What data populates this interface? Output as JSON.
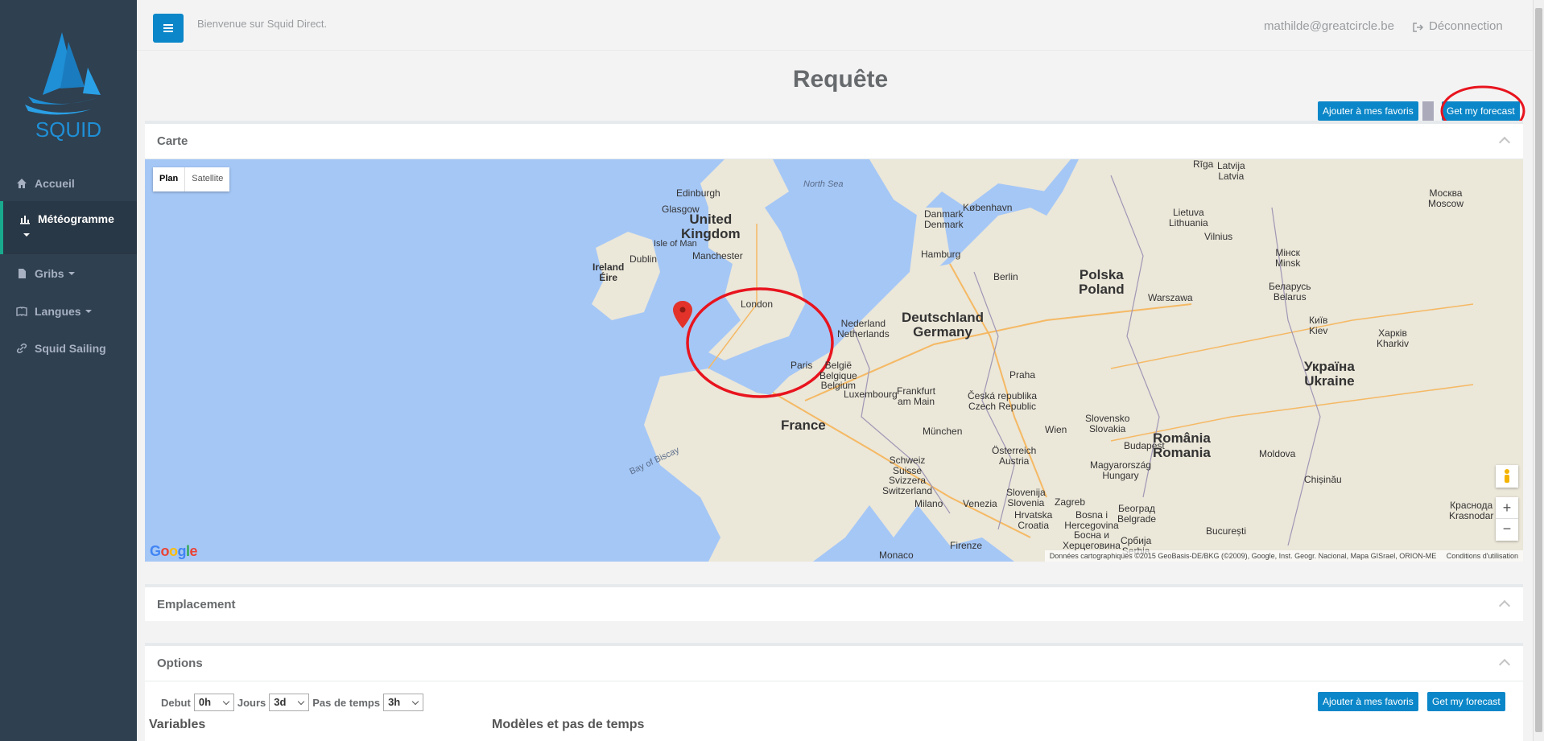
{
  "app": {
    "logo_text": "SQUID"
  },
  "sidebar": {
    "items": [
      {
        "label": "Accueil",
        "icon": "home-icon"
      },
      {
        "label": "Météogramme",
        "icon": "bar-chart-icon"
      },
      {
        "label": "Gribs",
        "icon": "file-icon"
      },
      {
        "label": "Langues",
        "icon": "book-icon"
      },
      {
        "label": "Squid Sailing",
        "icon": "link-icon"
      }
    ]
  },
  "topbar": {
    "welcome": "Bienvenue sur Squid Direct.",
    "user": "mathilde@greatcircle.be",
    "logout": "Déconnection"
  },
  "page": {
    "title": "Requête",
    "favorite_button": "Ajouter à mes favoris",
    "forecast_button": "Get my forecast"
  },
  "panels": {
    "map_title": "Carte",
    "location_title": "Emplacement",
    "options_title": "Options"
  },
  "map": {
    "type_plan": "Plan",
    "type_satellite": "Satellite",
    "google": "Google",
    "attribution": "Données cartographiques ©2015 GeoBasis-DE/BKG (©2009), Google, Inst. Geogr. Nacional, Mapa GISrael, ORION-ME",
    "terms": "Conditions d'utilisation",
    "labels": {
      "north_sea": "North Sea",
      "bay_biscay": "Bay of Biscay",
      "uk": "United\nKingdom",
      "ireland": "Ireland\nÉire",
      "france": "France",
      "germany": "Deutschland\nGermany",
      "poland": "Polska\nPoland",
      "ukraine": "Україна\nUkraine",
      "romania": "România\nRomania",
      "netherlands": "Nederland\nNetherlands",
      "belgium": "België\nBelgique\nBelgium",
      "luxembourg": "Luxembourg",
      "denmark": "Danmark\nDenmark",
      "latvia": "Latvija\nLatvia",
      "lithuania": "Lietuva\nLithuania",
      "belarus": "Беларусь\nBelarus",
      "switzerland": "Schweiz\nSuisse\nSvizzera\nSwitzerland",
      "czech": "Česká republika\nCzech Republic",
      "slovakia": "Slovensko\nSlovakia",
      "austria": "Österreich\nAustria",
      "hungary": "Magyarország\nHungary",
      "moldova": "Moldova",
      "slovenia": "Slovenija\nSlovenia",
      "croatia": "Hrvatska\nCroatia",
      "bosnia": "Bosna i\nHercegovina\nБосна и\nХерцеговина",
      "serbia": "Србија\nSerbia",
      "edinburgh": "Edinburgh",
      "glasgow": "Glasgow",
      "isle_of_man": "Isle of Man",
      "dublin": "Dublin",
      "manchester": "Manchester",
      "london": "London",
      "paris": "Paris",
      "hamburg": "Hamburg",
      "berlin": "Berlin",
      "frankfurt": "Frankfurt\nam Main",
      "munchen": "München",
      "praha": "Praha",
      "wien": "Wien",
      "warszawa": "Warszawa",
      "kobenhavn": "København",
      "riga": "Rīga",
      "vilnius": "Vilnius",
      "minsk": "Мінск\nMinsk",
      "moskva": "Москва\nMoscow",
      "kyiv": "Київ\nKiev",
      "kharkiv": "Харків\nKharkiv",
      "budapest": "Budapest",
      "zagreb": "Zagreb",
      "beograd": "Београд\nBelgrade",
      "bucuresti": "București",
      "chisinau": "Chișinău",
      "krasnodar": "Краснода\nKrasnodar",
      "milano": "Milano",
      "venezia": "Venezia",
      "firenze": "Firenze",
      "monaco": "Monaco"
    }
  },
  "options": {
    "debut_label": "Debut",
    "debut_value": "0h",
    "jours_label": "Jours",
    "jours_value": "3d",
    "pas_label": "Pas de temps",
    "pas_value": "3h",
    "variables": "Variables",
    "modeles": "Modèles et pas de temps"
  },
  "colors": {
    "sidebar": "#2f4050",
    "accent": "#0b87c9",
    "annotation": "#e8141e",
    "sea": "#a5c7f6",
    "land": "#ebe7d9"
  }
}
